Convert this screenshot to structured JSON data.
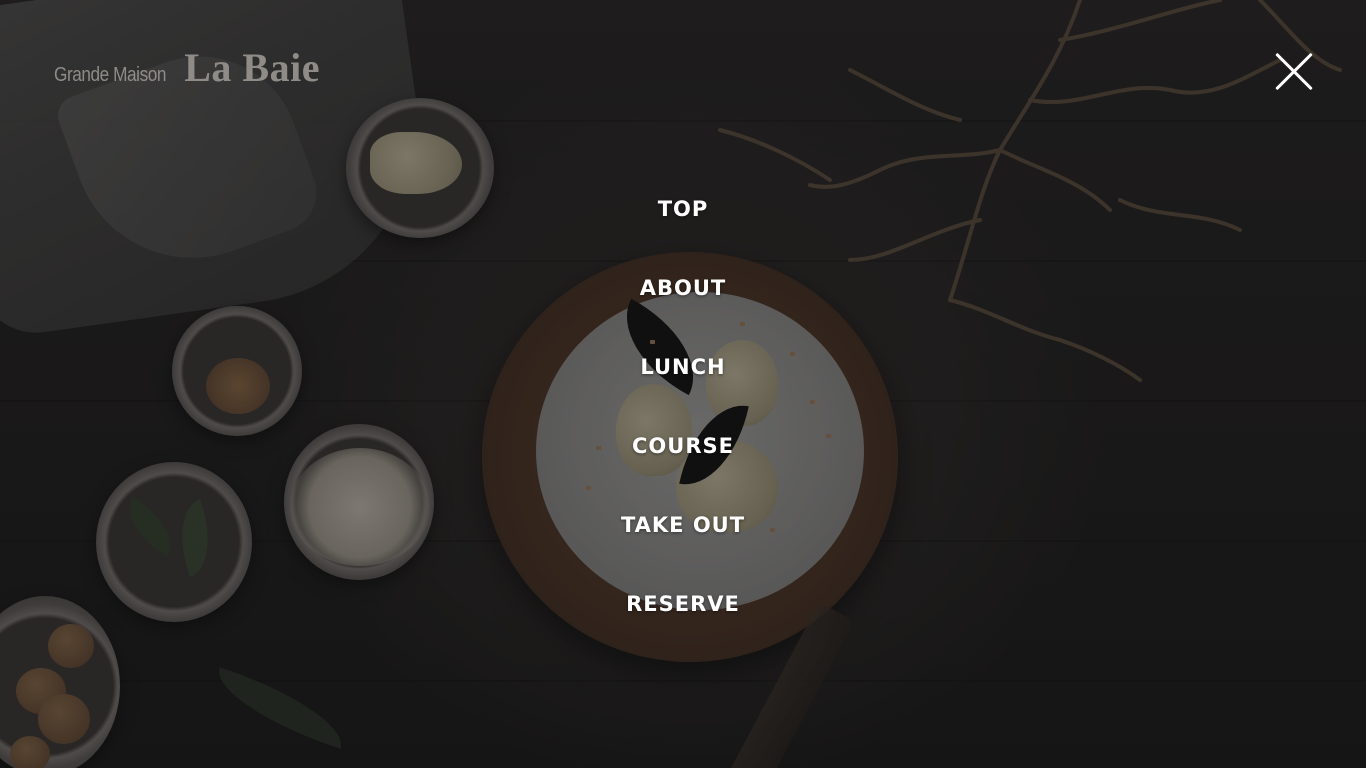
{
  "brand": {
    "sub": "Grande Maison",
    "main": "La Baie"
  },
  "close": {
    "icon": "close-icon"
  },
  "menu": {
    "items": [
      {
        "label": "TOP"
      },
      {
        "label": "ABOUT"
      },
      {
        "label": "LUNCH"
      },
      {
        "label": "COURSE"
      },
      {
        "label": "TAKE OUT"
      },
      {
        "label": "RESERVE"
      }
    ]
  },
  "colors": {
    "overlay": "#141416",
    "menu_text": "#ffffff",
    "logo_text": "#8f8c88"
  }
}
